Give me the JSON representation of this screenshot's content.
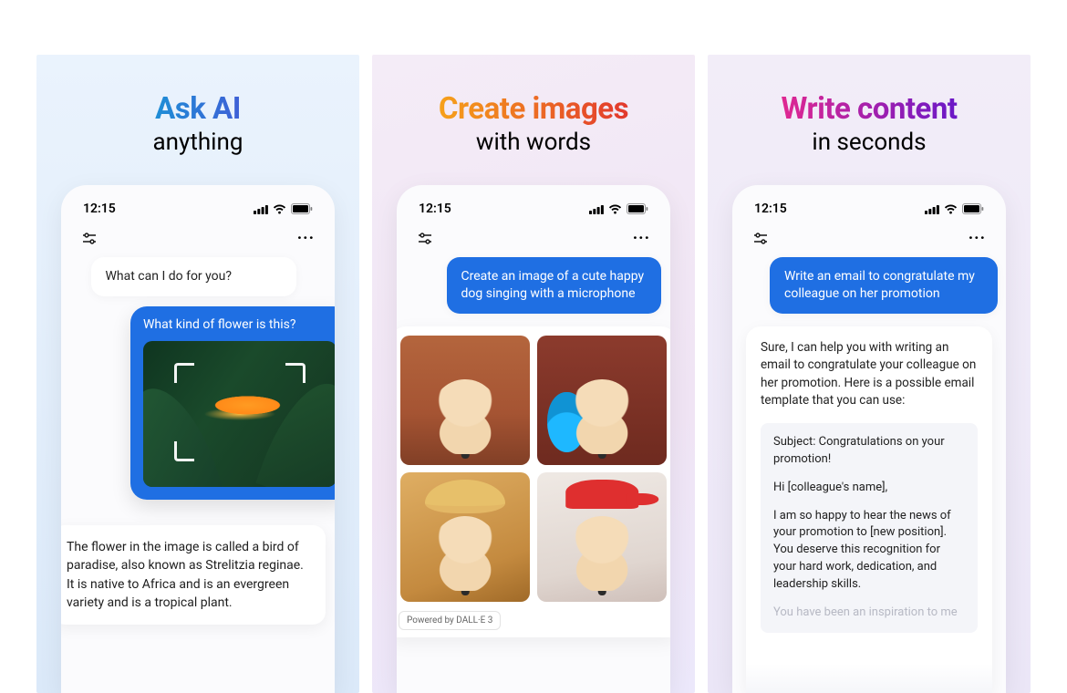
{
  "panels": [
    {
      "headline_main": "Ask AI",
      "headline_sub": "anything",
      "status_time": "12:15",
      "ai_greeting": "What can I do for you?",
      "user_question": "What kind of flower is this?",
      "ai_response": "The flower in the image is called a bird of paradise, also known as Strelitzia reginae. It is native to Africa and is an evergreen variety and is a tropical plant."
    },
    {
      "headline_main": "Create images",
      "headline_sub": "with words",
      "status_time": "12:15",
      "user_prompt": "Create an image of a cute happy dog singing with a microphone",
      "powered_by": "Powered by DALL·E 3"
    },
    {
      "headline_main": "Write content",
      "headline_sub": "in seconds",
      "status_time": "12:15",
      "user_prompt": "Write an email to congratulate my colleague on her promotion",
      "ai_intro": "Sure, I can help you with writing an email to congratulate your colleague on her promotion. Here is a possible email template that you can use:",
      "email": {
        "subject": "Subject: Congratulations on your promotion!",
        "greeting": "Hi [colleague's name],",
        "body1": "I am so happy to hear the news of your promotion to [new position]. You deserve this recognition for your hard work, dedication, and leadership skills.",
        "body2": "You have been an inspiration to me"
      }
    }
  ]
}
